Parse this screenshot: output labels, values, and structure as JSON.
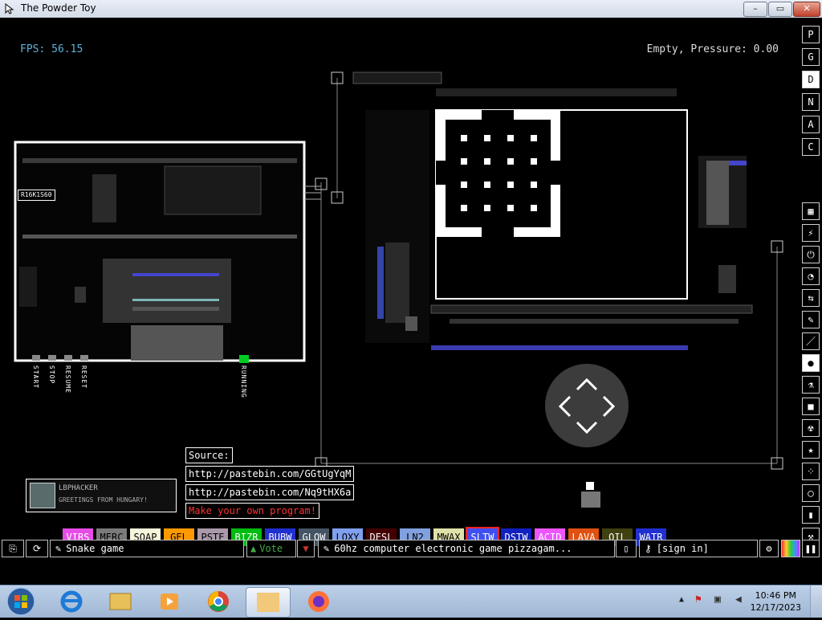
{
  "window": {
    "title": "The Powder Toy",
    "min": "–",
    "max": "▭",
    "close": "✕"
  },
  "hud": {
    "fps": "FPS: 56.15",
    "status": "Empty, Pressure: 0.00"
  },
  "display_buttons": [
    "P",
    "G",
    "D",
    "N",
    "A",
    "C"
  ],
  "display_active": 2,
  "tool_icons": [
    "grid-icon",
    "plug-icon",
    "power-icon",
    "clock-icon",
    "arrows-icon",
    "brush-icon",
    "line-icon",
    "drop-icon",
    "flask-icon",
    "box-icon",
    "radiation-icon",
    "star-icon",
    "dots-icon",
    "bulb-icon",
    "pin-icon",
    "hammer-icon",
    "search-icon"
  ],
  "tool_glyphs": [
    "▦",
    "⚡",
    "⏻",
    "◔",
    "⇆",
    "✎",
    "／",
    "●",
    "⚗",
    "■",
    "☢",
    "★",
    "⁘",
    "◯",
    "▮",
    "⚒",
    "⌕"
  ],
  "tools_active": 7,
  "board_labels": {
    "chip": "R16K1S60",
    "buttons": [
      "START",
      "STOP",
      "RESUME",
      "RESET"
    ],
    "running": "RUNNING"
  },
  "notes": {
    "source": "Source:",
    "link1": "http://pastebin.com/GGtUgYqM",
    "link2": "http://pastebin.com/Nq9tHX6a",
    "make": "Make your own program!"
  },
  "sign": {
    "name": "LBPHACKER",
    "subtitle": "GREETINGS FROM HUNGARY!"
  },
  "elements": [
    {
      "name": "VIRS",
      "bg": "#e64ce6",
      "fg": "#ffffff"
    },
    {
      "name": "MERC",
      "bg": "#7a7a7a",
      "fg": "#000000"
    },
    {
      "name": "SOAP",
      "bg": "#f5f5dc",
      "fg": "#000000"
    },
    {
      "name": "GEL",
      "bg": "#ff9900",
      "fg": "#000000"
    },
    {
      "name": "PSTE",
      "bg": "#aa99aa",
      "fg": "#000000"
    },
    {
      "name": "BIZR",
      "bg": "#00bb11",
      "fg": "#ffffff"
    },
    {
      "name": "BUBW",
      "bg": "#2030d0",
      "fg": "#ffffff"
    },
    {
      "name": "GLOW",
      "bg": "#445464",
      "fg": "#ffffff"
    },
    {
      "name": "LOXY",
      "bg": "#80a0ef",
      "fg": "#000000"
    },
    {
      "name": "DESL",
      "bg": "#440000",
      "fg": "#ffffff"
    },
    {
      "name": "LN2",
      "bg": "#80a0df",
      "fg": "#000000"
    },
    {
      "name": "MWAX",
      "bg": "#e0e0aa",
      "fg": "#000000"
    },
    {
      "name": "SLTW",
      "bg": "#4050f0",
      "fg": "#ffffff"
    },
    {
      "name": "DSTW",
      "bg": "#1020c0",
      "fg": "#ffffff"
    },
    {
      "name": "ACID",
      "bg": "#ed55ff",
      "fg": "#ffffff"
    },
    {
      "name": "LAVA",
      "bg": "#e05010",
      "fg": "#ffffff"
    },
    {
      "name": "OIL",
      "bg": "#404010",
      "fg": "#ffffff"
    },
    {
      "name": "WATR",
      "bg": "#2030d0",
      "fg": "#ffffff"
    }
  ],
  "selected_element": "SLTW",
  "bottombar": {
    "save_title": "Snake game",
    "vote": "Vote",
    "description": "60hz computer electronic game pizzagam...",
    "signin": "[sign in]"
  },
  "taskbar": {
    "time": "10:46 PM",
    "date": "12/17/2023"
  }
}
